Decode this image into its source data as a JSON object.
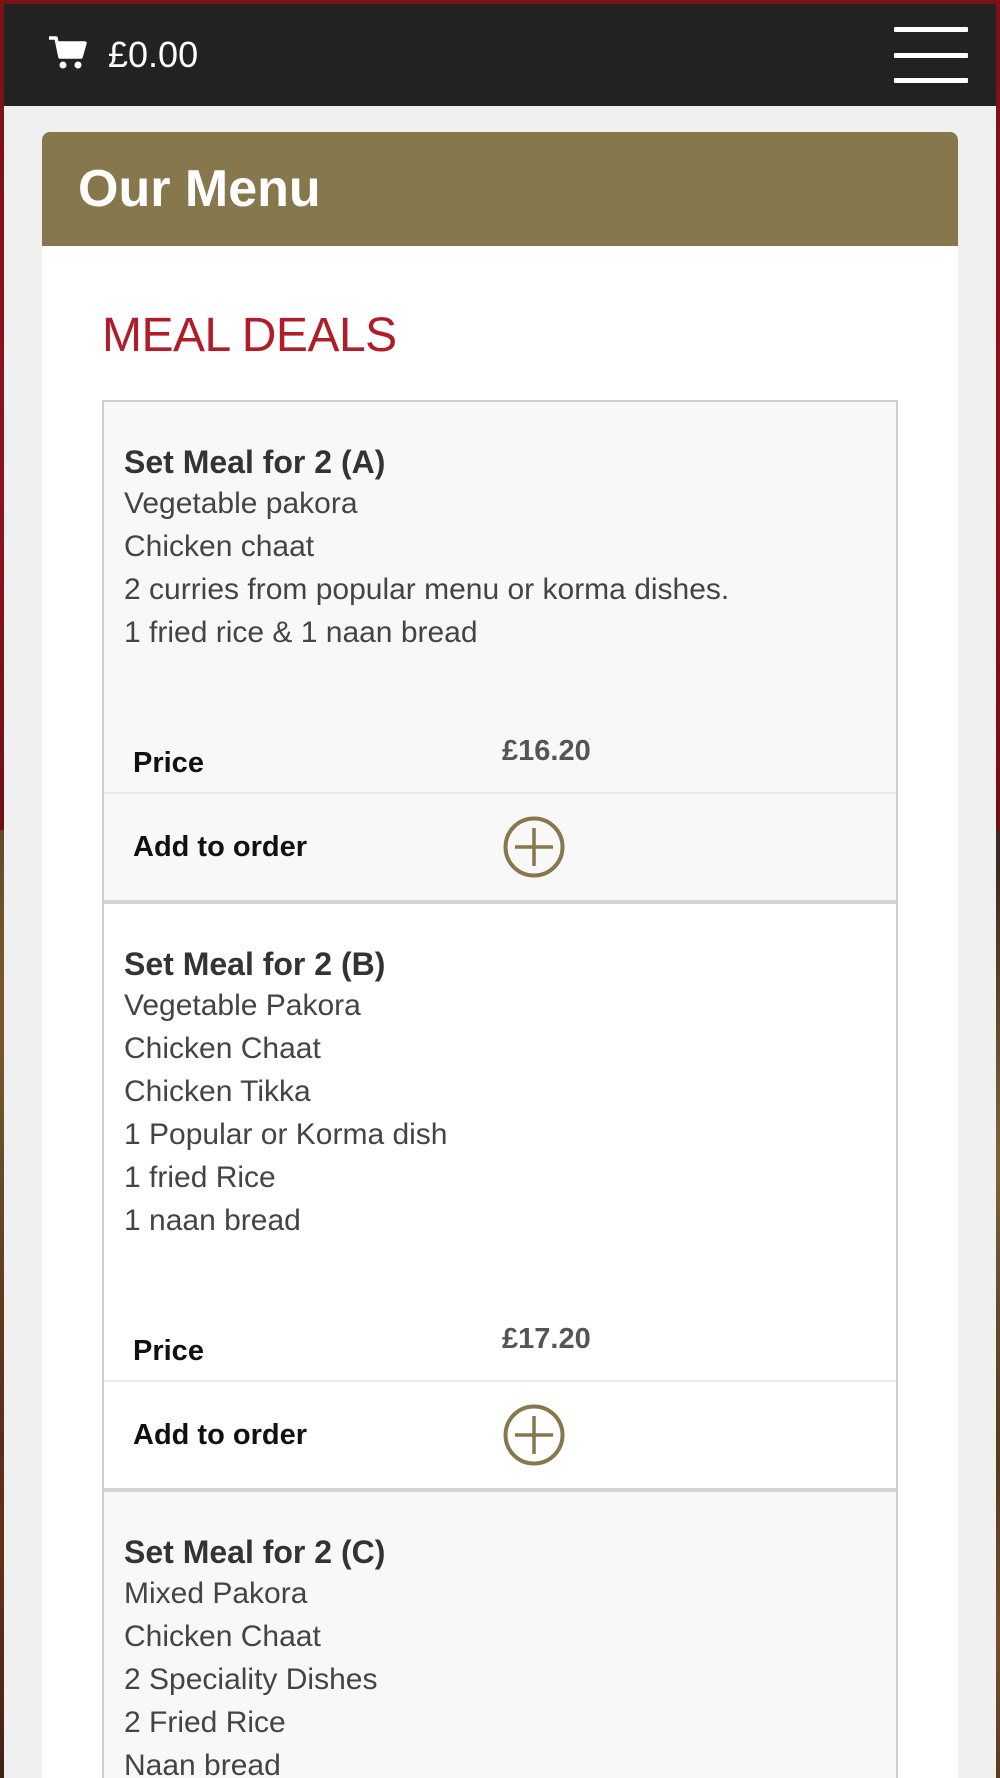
{
  "header": {
    "cart_icon": "shopping-cart-icon",
    "cart_total": "£0.00",
    "menu_icon": "hamburger-menu-icon"
  },
  "panel": {
    "title": "Our Menu"
  },
  "section": {
    "title": "MEAL DEALS"
  },
  "deals": [
    {
      "name": "Set Meal for 2 (A)",
      "items": [
        "Vegetable pakora",
        "Chicken chaat",
        "2 curries from popular menu or korma dishes.",
        "1 fried rice & 1 naan bread"
      ],
      "price_label": "Price",
      "price": "£16.20",
      "order_label": "Add to order"
    },
    {
      "name": "Set Meal for 2 (B)",
      "items": [
        "Vegetable Pakora",
        "Chicken Chaat",
        "Chicken Tikka",
        "1 Popular or Korma dish",
        "1 fried Rice",
        "1 naan bread"
      ],
      "price_label": "Price",
      "price": "£17.20",
      "order_label": "Add to order"
    },
    {
      "name": "Set Meal for 2 (C)",
      "items": [
        "Mixed Pakora",
        "Chicken Chaat",
        "2 Speciality Dishes",
        "2 Fried Rice",
        "Naan bread"
      ]
    }
  ],
  "colors": {
    "header_bg": "#222222",
    "panel_heading_bg": "#87774d",
    "section_title": "#b01c28",
    "add_icon": "#87774d"
  }
}
